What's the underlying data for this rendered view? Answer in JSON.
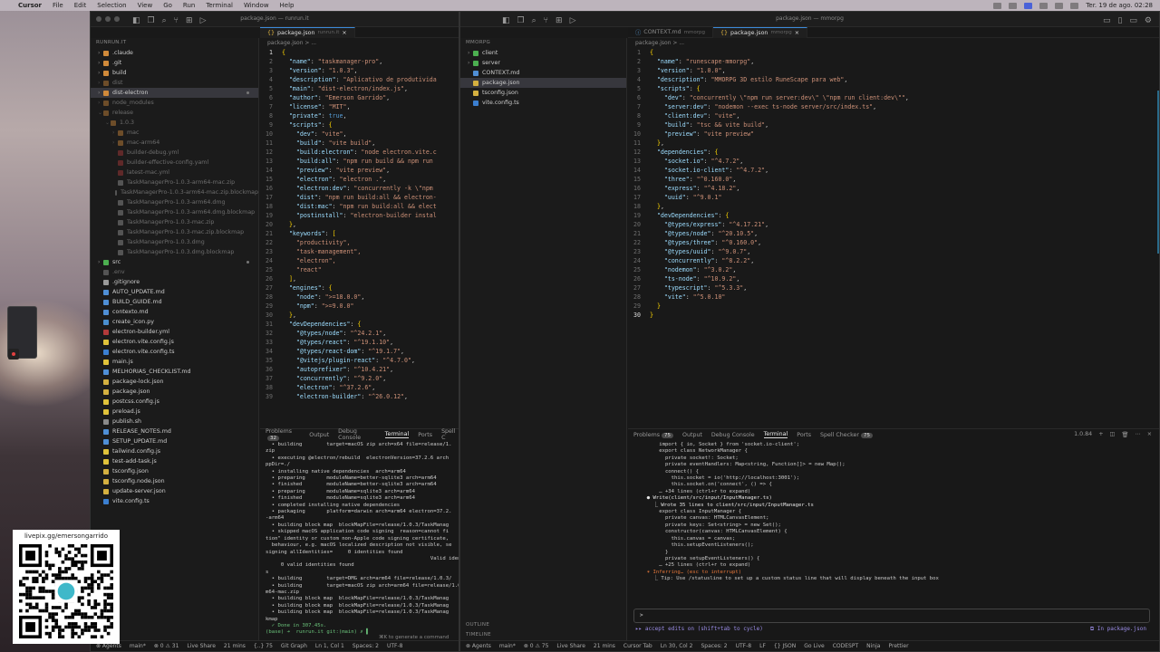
{
  "menubar": {
    "app": "Cursor",
    "items": [
      "File",
      "Edit",
      "Selection",
      "View",
      "Go",
      "Run",
      "Terminal",
      "Window",
      "Help"
    ],
    "clock": "Ter. 19 de ago. 02:28"
  },
  "window1": {
    "title": "package.json — runrun.it",
    "explorer_header": "RUNRUN.IT",
    "tree": [
      {
        "label": ".claude",
        "type": "folder",
        "indent": 0
      },
      {
        "label": ".git",
        "type": "folder",
        "indent": 0
      },
      {
        "label": "build",
        "type": "folder",
        "indent": 0
      },
      {
        "label": "dist",
        "type": "folder",
        "indent": 0,
        "dim": true
      },
      {
        "label": "dist-electron",
        "type": "folder",
        "indent": 0,
        "sel": true,
        "dot": true
      },
      {
        "label": "node_modules",
        "type": "folder",
        "indent": 0,
        "dim": true
      },
      {
        "label": "release",
        "type": "folder",
        "indent": 0,
        "open": true,
        "dim": true
      },
      {
        "label": "1.0.3",
        "type": "folder",
        "indent": 1,
        "open": true,
        "dim": true
      },
      {
        "label": "mac",
        "type": "folder",
        "indent": 2,
        "dim": true
      },
      {
        "label": "mac-arm64",
        "type": "folder",
        "indent": 2,
        "dim": true
      },
      {
        "label": "builder-debug.yml",
        "type": "file",
        "indent": 2,
        "dim": true
      },
      {
        "label": "builder-effective-config.yaml",
        "type": "file",
        "indent": 2,
        "dim": true
      },
      {
        "label": "latest-mac.yml",
        "type": "file",
        "indent": 2,
        "dim": true
      },
      {
        "label": "TaskManagerPro-1.0.3-arm64-mac.zip",
        "type": "file",
        "indent": 2,
        "dim": true
      },
      {
        "label": "TaskManagerPro-1.0.3-arm64-mac.zip.blockmap",
        "type": "file",
        "indent": 2,
        "dim": true
      },
      {
        "label": "TaskManagerPro-1.0.3-arm64.dmg",
        "type": "file",
        "indent": 2,
        "dim": true
      },
      {
        "label": "TaskManagerPro-1.0.3-arm64.dmg.blockmap",
        "type": "file",
        "indent": 2,
        "dim": true
      },
      {
        "label": "TaskManagerPro-1.0.3-mac.zip",
        "type": "file",
        "indent": 2,
        "dim": true
      },
      {
        "label": "TaskManagerPro-1.0.3-mac.zip.blockmap",
        "type": "file",
        "indent": 2,
        "dim": true
      },
      {
        "label": "TaskManagerPro-1.0.3.dmg",
        "type": "file",
        "indent": 2,
        "dim": true
      },
      {
        "label": "TaskManagerPro-1.0.3.dmg.blockmap",
        "type": "file",
        "indent": 2,
        "dim": true
      },
      {
        "label": "src",
        "type": "folder",
        "indent": 0,
        "dot": true
      },
      {
        "label": ".env",
        "type": "file",
        "indent": 0,
        "dim": true
      },
      {
        "label": ".gitignore",
        "type": "file",
        "indent": 0
      },
      {
        "label": "AUTO_UPDATE.md",
        "type": "file",
        "indent": 0
      },
      {
        "label": "BUILD_GUIDE.md",
        "type": "file",
        "indent": 0
      },
      {
        "label": "contexto.md",
        "type": "file",
        "indent": 0
      },
      {
        "label": "create_icon.py",
        "type": "file",
        "indent": 0
      },
      {
        "label": "electron-builder.yml",
        "type": "file",
        "indent": 0
      },
      {
        "label": "electron.vite.config.js",
        "type": "file",
        "indent": 0
      },
      {
        "label": "electron.vite.config.ts",
        "type": "file",
        "indent": 0
      },
      {
        "label": "main.js",
        "type": "file",
        "indent": 0
      },
      {
        "label": "MELHORIAS_CHECKLIST.md",
        "type": "file",
        "indent": 0
      },
      {
        "label": "package-lock.json",
        "type": "file",
        "indent": 0
      },
      {
        "label": "package.json",
        "type": "file",
        "indent": 0
      },
      {
        "label": "postcss.config.js",
        "type": "file",
        "indent": 0
      },
      {
        "label": "preload.js",
        "type": "file",
        "indent": 0
      },
      {
        "label": "publish.sh",
        "type": "file",
        "indent": 0
      },
      {
        "label": "RELEASE_NOTES.md",
        "type": "file",
        "indent": 0
      },
      {
        "label": "SETUP_UPDATE.md",
        "type": "file",
        "indent": 0
      },
      {
        "label": "tailwind.config.js",
        "type": "file",
        "indent": 0
      },
      {
        "label": "test-add-task.js",
        "type": "file",
        "indent": 0
      },
      {
        "label": "tsconfig.json",
        "type": "file",
        "indent": 0
      },
      {
        "label": "tsconfig.node.json",
        "type": "file",
        "indent": 0
      },
      {
        "label": "update-server.json",
        "type": "file",
        "indent": 0
      },
      {
        "label": "vite.config.ts",
        "type": "file",
        "indent": 0
      }
    ],
    "tab": {
      "label": "package.json",
      "sub": "runrun.it"
    },
    "breadcrumb": "package.json > ...",
    "code": [
      {
        "n": "1",
        "t": "{"
      },
      {
        "n": "2",
        "t": "  \"name\": \"taskmanager-pro\","
      },
      {
        "n": "3",
        "t": "  \"version\": \"1.0.3\","
      },
      {
        "n": "4",
        "t": "  \"description\": \"Aplicativo de produtivida"
      },
      {
        "n": "5",
        "t": "  \"main\": \"dist-electron/index.js\","
      },
      {
        "n": "6",
        "t": "  \"author\": \"Emerson Garrido\","
      },
      {
        "n": "7",
        "t": "  \"license\": \"MIT\","
      },
      {
        "n": "8",
        "t": "  \"private\": true,"
      },
      {
        "n": "9",
        "t": "  \"scripts\": {"
      },
      {
        "n": "10",
        "t": "    \"dev\": \"vite\","
      },
      {
        "n": "11",
        "t": "    \"build\": \"vite build\","
      },
      {
        "n": "12",
        "t": "    \"build:electron\": \"node electron.vite.c"
      },
      {
        "n": "13",
        "t": "    \"build:all\": \"npm run build && npm run"
      },
      {
        "n": "14",
        "t": "    \"preview\": \"vite preview\","
      },
      {
        "n": "15",
        "t": "    \"electron\": \"electron .\","
      },
      {
        "n": "16",
        "t": "    \"electron:dev\": \"concurrently -k \\\"npm"
      },
      {
        "n": "17",
        "t": "    \"dist\": \"npm run build:all && electron-"
      },
      {
        "n": "18",
        "t": "    \"dist:mac\": \"npm run build:all && elect"
      },
      {
        "n": "19",
        "t": "    \"postinstall\": \"electron-builder instal"
      },
      {
        "n": "20",
        "t": "  },"
      },
      {
        "n": "21",
        "t": "  \"keywords\": ["
      },
      {
        "n": "22",
        "t": "    \"productivity\","
      },
      {
        "n": "23",
        "t": "    \"task-management\","
      },
      {
        "n": "24",
        "t": "    \"electron\","
      },
      {
        "n": "25",
        "t": "    \"react\""
      },
      {
        "n": "26",
        "t": "  ],"
      },
      {
        "n": "27",
        "t": "  \"engines\": {"
      },
      {
        "n": "28",
        "t": "    \"node\": \">=18.0.0\","
      },
      {
        "n": "29",
        "t": "    \"npm\": \">=9.0.0\""
      },
      {
        "n": "30",
        "t": "  },"
      },
      {
        "n": "31",
        "t": "  \"devDependencies\": {"
      },
      {
        "n": "32",
        "t": "    \"@types/node\": \"^24.2.1\","
      },
      {
        "n": "33",
        "t": "    \"@types/react\": \"^19.1.10\","
      },
      {
        "n": "34",
        "t": "    \"@types/react-dom\": \"^19.1.7\","
      },
      {
        "n": "35",
        "t": "    \"@vitejs/plugin-react\": \"^4.7.0\","
      },
      {
        "n": "36",
        "t": "    \"autoprefixer\": \"^10.4.21\","
      },
      {
        "n": "37",
        "t": "    \"concurrently\": \"^9.2.0\","
      },
      {
        "n": "38",
        "t": "    \"electron\": \"^37.2.6\","
      },
      {
        "n": "39",
        "t": "    \"electron-builder\": \"^26.0.12\","
      }
    ],
    "panel_tabs": [
      "Problems",
      "Output",
      "Debug Console",
      "Terminal",
      "Ports",
      "Spell C"
    ],
    "problems_count": "32",
    "terminal": [
      "  • building        target=macOS zip arch=x64 file=release/1.",
      "zip",
      "  • executing @electron/rebuild  electronVersion=37.2.6 arch",
      "ppDir=./",
      "  • installing native dependencies  arch=arm64",
      "  • preparing       moduleName=better-sqlite3 arch=arm64",
      "  • finished        moduleName=better-sqlite3 arch=arm64",
      "  • preparing       moduleName=sqlite3 arch=arm64",
      "  • finished        moduleName=sqlite3 arch=arm64",
      "  • completed installing native dependencies",
      "  • packaging       platform=darwin arch=arm64 electron=37.2.",
      "-arm64",
      "  • building block map  blockMapFile=release/1.0.3/TaskManag",
      "  • skipped macOS application code signing  reason=cannot fi",
      "tion\" identity or custom non-Apple code signing certificate,",
      "  behaviour, e.g. macOS localized description not visible, se",
      "signing allIdentities=     0 identities found",
      "                                                      Valid identi",
      "",
      "     0 valid identities found",
      "s",
      "  • building        target=DMG arch=arm64 file=release/1.0.3/",
      "",
      "  • building        target=macOS zip arch=arm64 file=release/1.0.3/",
      "m64-mac.zip",
      "  • building block map  blockMapFile=release/1.0.3/TaskManag",
      "  • building block map  blockMapFile=release/1.0.3/TaskManag",
      "  • building block map  blockMapFile=release/1.0.3/TaskManag",
      "kmap",
      "  ✓ Done in 307.45s.",
      "(base) ➜  runrun.it git:(main) ✗ ▌"
    ],
    "status": [
      "⊗ Agents",
      "main*",
      "⊗ 0 ⚠ 31",
      "Live Share",
      "21 mins",
      "{..} 75",
      "Git Graph",
      "Ln 1, Col 1",
      "Spaces: 2",
      "UTF-8"
    ]
  },
  "window2": {
    "title": "package.json — mmorpg",
    "explorer_header": "MMORPG",
    "tree": [
      {
        "label": "client",
        "type": "folder",
        "indent": 0
      },
      {
        "label": "server",
        "type": "folder",
        "indent": 0
      },
      {
        "label": "CONTEXT.md",
        "type": "file",
        "indent": 0
      },
      {
        "label": "package.json",
        "type": "file",
        "indent": 0,
        "sel": true
      },
      {
        "label": "tsconfig.json",
        "type": "file",
        "indent": 0
      },
      {
        "label": "vite.config.ts",
        "type": "file",
        "indent": 0
      }
    ],
    "outline": "OUTLINE",
    "timeline": "TIMELINE",
    "tabs": [
      {
        "label": "CONTEXT.md",
        "sub": "mmorpg",
        "active": false
      },
      {
        "label": "package.json",
        "sub": "mmorpg",
        "active": true
      }
    ],
    "breadcrumb": "package.json > ...",
    "code": [
      {
        "n": "1",
        "t": "{"
      },
      {
        "n": "2",
        "t": "  \"name\": \"runescape-mmorpg\","
      },
      {
        "n": "3",
        "t": "  \"version\": \"1.0.0\","
      },
      {
        "n": "4",
        "t": "  \"description\": \"MMORPG 3D estilo RuneScape para web\","
      },
      {
        "n": "5",
        "t": "  \"scripts\": {"
      },
      {
        "n": "6",
        "t": "    \"dev\": \"concurrently \\\"npm run server:dev\\\" \\\"npm run client:dev\\\"\","
      },
      {
        "n": "7",
        "t": "    \"server:dev\": \"nodemon --exec ts-node server/src/index.ts\","
      },
      {
        "n": "8",
        "t": "    \"client:dev\": \"vite\","
      },
      {
        "n": "9",
        "t": "    \"build\": \"tsc && vite build\","
      },
      {
        "n": "10",
        "t": "    \"preview\": \"vite preview\""
      },
      {
        "n": "11",
        "t": "  },"
      },
      {
        "n": "12",
        "t": "  \"dependencies\": {"
      },
      {
        "n": "13",
        "t": "    \"socket.io\": \"^4.7.2\","
      },
      {
        "n": "14",
        "t": "    \"socket.io-client\": \"^4.7.2\","
      },
      {
        "n": "15",
        "t": "    \"three\": \"^0.160.0\","
      },
      {
        "n": "16",
        "t": "    \"express\": \"^4.18.2\","
      },
      {
        "n": "17",
        "t": "    \"uuid\": \"^9.0.1\""
      },
      {
        "n": "18",
        "t": "  },"
      },
      {
        "n": "19",
        "t": "  \"devDependencies\": {"
      },
      {
        "n": "20",
        "t": "    \"@types/express\": \"^4.17.21\","
      },
      {
        "n": "21",
        "t": "    \"@types/node\": \"^20.10.5\","
      },
      {
        "n": "22",
        "t": "    \"@types/three\": \"^0.160.0\","
      },
      {
        "n": "23",
        "t": "    \"@types/uuid\": \"^9.0.7\","
      },
      {
        "n": "24",
        "t": "    \"concurrently\": \"^8.2.2\","
      },
      {
        "n": "25",
        "t": "    \"nodemon\": \"^3.0.2\","
      },
      {
        "n": "26",
        "t": "    \"ts-node\": \"^10.9.2\","
      },
      {
        "n": "27",
        "t": "    \"typescript\": \"^5.3.3\","
      },
      {
        "n": "28",
        "t": "    \"vite\": \"^5.0.10\""
      },
      {
        "n": "29",
        "t": "  }"
      },
      {
        "n": "30",
        "t": "}"
      }
    ],
    "panel_tabs": [
      "Problems",
      "Output",
      "Debug Console",
      "Terminal",
      "Ports",
      "Spell Checker"
    ],
    "problems_count": "75",
    "spell_count": "75",
    "terminal_right": "1.0.84",
    "terminal": [
      "      import { io, Socket } from 'socket.io-client';",
      "      export class NetworkManager {",
      "        private socket!: Socket;",
      "        private eventHandlers: Map<string, Function[]> = new Map();",
      "        connect() {",
      "          this.socket = io('http://localhost:3001');",
      "          this.socket.on('connect', () => {",
      "      … +34 lines (ctrl+r to expand)",
      "",
      "  ● Write(client/src/input/InputManager.ts)",
      "    ⎿ Wrote 35 lines to client/src/input/InputManager.ts",
      "      export class InputManager {",
      "        private canvas: HTMLCanvasElement;",
      "        private keys: Set<string> = new Set();",
      "        constructor(canvas: HTMLCanvasElement) {",
      "          this.canvas = canvas;",
      "          this.setupEventListeners();",
      "        }",
      "        private setupEventListeners() {",
      "      … +25 lines (ctrl+r to expand)",
      "",
      "  ✶ Inferring… (esc to interrupt)",
      "    ⎿ Tip: Use /statusline to set up a custom status line that will display beneath the input box"
    ],
    "prompt": ">",
    "accept_edits": "▸▸ accept edits on (shift+tab to cycle)",
    "in_file": "⧉ In package.json",
    "generate_cmd": "⌘K to generate a command",
    "status": [
      "⊗ Agents",
      "main*",
      "⊗ 0 ⚠ 75",
      "Live Share",
      "21 mins",
      "Cursor Tab",
      "Ln 30, Col 2",
      "Spaces: 2",
      "UTF-8",
      "LF",
      "{} JSON",
      "Go Live",
      "CODESPT",
      "Ninja",
      "Prettier"
    ]
  },
  "overlay": {
    "qr_text": "livepix.gg/emersongarrido"
  }
}
